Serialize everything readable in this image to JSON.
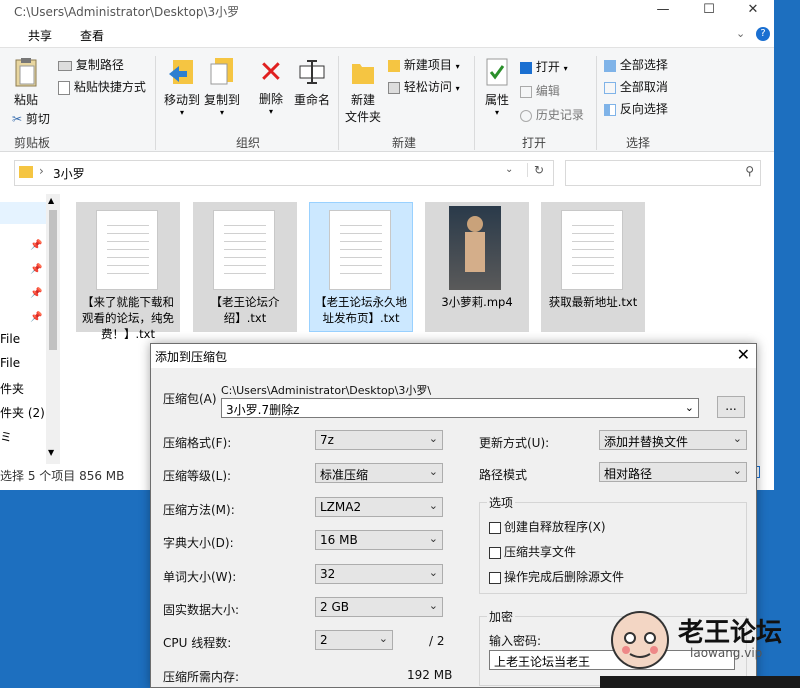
{
  "explorer": {
    "title": "C:\\Users\\Administrator\\Desktop\\3小罗",
    "window_buttons": {
      "minimize": "—",
      "maximize": "☐",
      "close": "✕"
    },
    "tabs": [
      "共享",
      "查看"
    ],
    "ribbon": {
      "clipboard": {
        "paste": "粘贴",
        "copy_path": "复制路径",
        "paste_shortcut": "粘贴快捷方式",
        "cut": "剪切",
        "group": "剪贴板"
      },
      "organize": {
        "move_to": "移动到",
        "copy_to": "复制到",
        "delete": "删除",
        "rename": "重命名",
        "group": "组织"
      },
      "new": {
        "new_folder_1": "新建",
        "new_folder_2": "文件夹",
        "new_item": "新建项目",
        "easy_access": "轻松访问",
        "group": "新建"
      },
      "open": {
        "properties": "属性",
        "open": "打开",
        "edit": "编辑",
        "history": "历史记录",
        "group": "打开"
      },
      "select": {
        "select_all": "全部选择",
        "select_none": "全部取消",
        "invert": "反向选择",
        "group": "选择"
      }
    },
    "breadcrumb": "3小罗",
    "nav_items": [
      "File",
      "File",
      "件夹",
      "件夹 (2)",
      "ミ"
    ],
    "files": [
      {
        "name": "【来了就能下载和观看的论坛，纯免费！】.txt"
      },
      {
        "name": "【老王论坛介绍】.txt"
      },
      {
        "name": "【老王论坛永久地址发布页】.txt"
      },
      {
        "name": "3小萝莉.mp4"
      },
      {
        "name": "获取最新地址.txt"
      }
    ],
    "status": "选择 5 个项目  856 MB"
  },
  "dialog": {
    "title": "添加到压缩包",
    "archive_label": "压缩包(A)",
    "archive_path": "C:\\Users\\Administrator\\Desktop\\3小罗\\",
    "archive_name": "3小罗.7删除z",
    "browse": "...",
    "format_label": "压缩格式(F):",
    "format_value": "7z",
    "level_label": "压缩等级(L):",
    "level_value": "标准压缩",
    "method_label": "压缩方法(M):",
    "method_value": "LZMA2",
    "dict_label": "字典大小(D):",
    "dict_value": "16 MB",
    "word_label": "单词大小(W):",
    "word_value": "32",
    "solid_label": "固实数据大小:",
    "solid_value": "2 GB",
    "cpu_label": "CPU 线程数:",
    "cpu_value": "2",
    "cpu_total": "/ 2",
    "memory_label": "压缩所需内存:",
    "memory_value": "192 MB",
    "update_label": "更新方式(U):",
    "update_value": "添加并替换文件",
    "path_label": "路径模式",
    "path_value": "相对路径",
    "options_title": "选项",
    "opt_sfx": "创建自释放程序(X)",
    "opt_shared": "压缩共享文件",
    "opt_delete": "操作完成后删除源文件",
    "encrypt_title": "加密",
    "password_label": "输入密码:",
    "password_value": "上老王论坛当老王"
  },
  "watermark": {
    "brand": "老王论坛",
    "url": "laowang.vip"
  }
}
